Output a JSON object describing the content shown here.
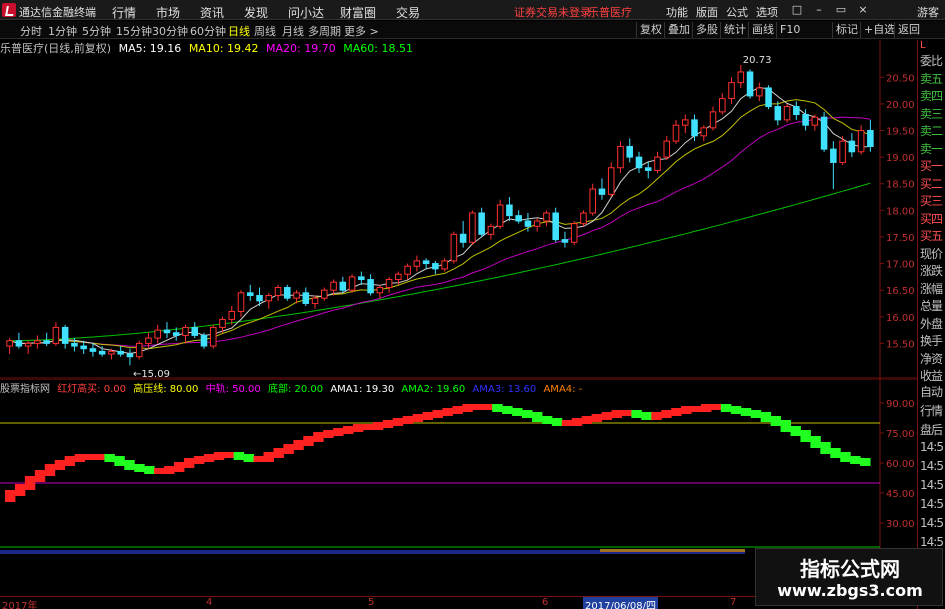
{
  "menubar": {
    "app_title": "通达信金融终端",
    "menus": [
      "行情",
      "市场",
      "资讯",
      "发现",
      "问小达",
      "财富圈",
      "交易"
    ],
    "status_text": "证券交易未登录",
    "stock_name": "乐普医疗",
    "right_items": [
      "功能",
      "版面",
      "公式",
      "选项"
    ],
    "guest": "游客"
  },
  "toolbar": {
    "periods": [
      "分时",
      "1分钟",
      "5分钟",
      "15分钟",
      "30分钟",
      "60分钟",
      "日线",
      "周线",
      "月线",
      "多周期",
      "更多 >"
    ],
    "active_period": "日线",
    "buttons": [
      "复权",
      "叠加",
      "多股",
      "统计",
      "画线",
      "F10",
      "标记",
      "+自选",
      "返回"
    ]
  },
  "main_header": {
    "title": "乐普医疗(日线,前复权)",
    "ma5": "MA5: 19.16",
    "ma10": "MA10: 19.42",
    "ma20": "MA20: 19.70",
    "ma60": "MA60: 18.51",
    "colors": {
      "ma5": "#ffffff",
      "ma10": "#ffff00",
      "ma20": "#ff00ff",
      "ma60": "#00ff00"
    }
  },
  "price_axis": [
    "20.50",
    "20.00",
    "19.50",
    "19.00",
    "18.50",
    "18.00",
    "17.50",
    "17.00",
    "16.50",
    "16.00",
    "15.50"
  ],
  "annotations": {
    "high": "20.73",
    "low": "15.09"
  },
  "side_panel": {
    "items": [
      "委比",
      "卖五",
      "卖四",
      "卖三",
      "卖二",
      "卖一",
      "买一",
      "买二",
      "买三",
      "买四",
      "买五",
      "现价",
      "涨跌",
      "涨幅",
      "总量",
      "外盘",
      "换手",
      "净资",
      "收益"
    ],
    "top_label": "L"
  },
  "side_panel2": {
    "items": [
      "自动",
      "行情",
      "盘后",
      "14:5",
      "14:5",
      "14:5",
      "14:5",
      "14:5",
      "14:5",
      "14:5"
    ]
  },
  "indicator_header": {
    "name": "股票指标网",
    "item1": "红灯高买: 0.00",
    "item2": "高压线: 80.00",
    "item3": "中轨: 50.00",
    "item4": "底部: 20.00",
    "item5": "AMA1: 19.30",
    "item6": "AMA2: 19.60",
    "item7": "AMA3: 13.60",
    "item8": "AMA4: -"
  },
  "indicator_axis": [
    "90.00",
    "75.00",
    "60.00",
    "45.00",
    "30.00"
  ],
  "date_axis": {
    "ticks": [
      "2017年",
      "4",
      "5",
      "6",
      "2017/06/08/四",
      "7"
    ],
    "selected": "2017/06/08/四"
  },
  "watermark": {
    "main": "指标公式网",
    "sub": "www.zbgs3.com"
  },
  "chart_data": {
    "type": "candlestick",
    "title": "乐普医疗(日线,前复权)",
    "ylim": [
      15.0,
      20.9
    ],
    "ma5_last": 19.16,
    "ma10_last": 19.42,
    "ma20_last": 19.7,
    "ma60_last": 18.51,
    "high": 20.73,
    "low": 15.09,
    "candles": [
      [
        15.45,
        15.6,
        15.3,
        15.55
      ],
      [
        15.55,
        15.7,
        15.4,
        15.45
      ],
      [
        15.45,
        15.55,
        15.3,
        15.5
      ],
      [
        15.5,
        15.65,
        15.4,
        15.55
      ],
      [
        15.55,
        15.7,
        15.45,
        15.5
      ],
      [
        15.5,
        15.9,
        15.45,
        15.8
      ],
      [
        15.8,
        15.85,
        15.4,
        15.5
      ],
      [
        15.5,
        15.6,
        15.35,
        15.45
      ],
      [
        15.45,
        15.55,
        15.3,
        15.4
      ],
      [
        15.4,
        15.5,
        15.25,
        15.35
      ],
      [
        15.35,
        15.45,
        15.25,
        15.3
      ],
      [
        15.3,
        15.4,
        15.2,
        15.35
      ],
      [
        15.35,
        15.45,
        15.25,
        15.3
      ],
      [
        15.3,
        15.4,
        15.09,
        15.25
      ],
      [
        15.25,
        15.55,
        15.2,
        15.5
      ],
      [
        15.5,
        15.7,
        15.4,
        15.6
      ],
      [
        15.6,
        15.85,
        15.5,
        15.75
      ],
      [
        15.75,
        15.9,
        15.6,
        15.7
      ],
      [
        15.7,
        15.8,
        15.55,
        15.65
      ],
      [
        15.65,
        15.85,
        15.5,
        15.8
      ],
      [
        15.8,
        15.9,
        15.6,
        15.65
      ],
      [
        15.65,
        15.7,
        15.4,
        15.45
      ],
      [
        15.45,
        15.85,
        15.4,
        15.8
      ],
      [
        15.8,
        16.0,
        15.7,
        15.95
      ],
      [
        15.95,
        16.2,
        15.85,
        16.1
      ],
      [
        16.1,
        16.5,
        16.0,
        16.45
      ],
      [
        16.45,
        16.6,
        16.3,
        16.4
      ],
      [
        16.4,
        16.55,
        16.2,
        16.3
      ],
      [
        16.3,
        16.45,
        16.15,
        16.4
      ],
      [
        16.4,
        16.6,
        16.3,
        16.55
      ],
      [
        16.55,
        16.6,
        16.3,
        16.35
      ],
      [
        16.35,
        16.5,
        16.25,
        16.45
      ],
      [
        16.45,
        16.55,
        16.2,
        16.25
      ],
      [
        16.25,
        16.4,
        16.15,
        16.35
      ],
      [
        16.35,
        16.55,
        16.3,
        16.5
      ],
      [
        16.5,
        16.7,
        16.4,
        16.65
      ],
      [
        16.65,
        16.75,
        16.45,
        16.5
      ],
      [
        16.5,
        16.8,
        16.45,
        16.75
      ],
      [
        16.75,
        16.85,
        16.6,
        16.7
      ],
      [
        16.7,
        16.8,
        16.4,
        16.45
      ],
      [
        16.45,
        16.6,
        16.35,
        16.55
      ],
      [
        16.55,
        16.75,
        16.45,
        16.7
      ],
      [
        16.7,
        16.85,
        16.6,
        16.8
      ],
      [
        16.8,
        17.0,
        16.7,
        16.95
      ],
      [
        16.95,
        17.15,
        16.85,
        17.05
      ],
      [
        17.05,
        17.1,
        16.9,
        17.0
      ],
      [
        17.0,
        17.05,
        16.8,
        16.9
      ],
      [
        16.9,
        17.1,
        16.85,
        17.05
      ],
      [
        17.05,
        17.6,
        17.0,
        17.55
      ],
      [
        17.55,
        17.8,
        17.3,
        17.4
      ],
      [
        17.4,
        18.0,
        17.35,
        17.95
      ],
      [
        17.95,
        18.05,
        17.5,
        17.55
      ],
      [
        17.55,
        17.75,
        17.45,
        17.7
      ],
      [
        17.7,
        18.2,
        17.65,
        18.1
      ],
      [
        18.1,
        18.25,
        17.8,
        17.9
      ],
      [
        17.9,
        18.0,
        17.75,
        17.8
      ],
      [
        17.8,
        17.95,
        17.6,
        17.7
      ],
      [
        17.7,
        17.85,
        17.6,
        17.8
      ],
      [
        17.8,
        18.0,
        17.7,
        17.95
      ],
      [
        17.95,
        18.05,
        17.4,
        17.45
      ],
      [
        17.45,
        17.6,
        17.3,
        17.4
      ],
      [
        17.4,
        17.8,
        17.35,
        17.75
      ],
      [
        17.75,
        18.0,
        17.7,
        17.95
      ],
      [
        17.95,
        18.5,
        17.9,
        18.4
      ],
      [
        18.4,
        18.6,
        18.2,
        18.3
      ],
      [
        18.3,
        18.9,
        18.25,
        18.8
      ],
      [
        18.8,
        19.3,
        18.7,
        19.2
      ],
      [
        19.2,
        19.35,
        18.9,
        19.0
      ],
      [
        19.0,
        19.1,
        18.7,
        18.8
      ],
      [
        18.8,
        18.9,
        18.6,
        18.75
      ],
      [
        18.75,
        19.1,
        18.7,
        19.0
      ],
      [
        19.0,
        19.4,
        18.95,
        19.3
      ],
      [
        19.3,
        19.7,
        19.25,
        19.6
      ],
      [
        19.6,
        19.8,
        19.45,
        19.7
      ],
      [
        19.7,
        19.8,
        19.3,
        19.4
      ],
      [
        19.4,
        19.6,
        19.3,
        19.55
      ],
      [
        19.55,
        19.95,
        19.5,
        19.85
      ],
      [
        19.85,
        20.2,
        19.8,
        20.1
      ],
      [
        20.1,
        20.5,
        20.0,
        20.4
      ],
      [
        20.4,
        20.73,
        20.3,
        20.6
      ],
      [
        20.6,
        20.65,
        20.1,
        20.15
      ],
      [
        20.15,
        20.4,
        20.05,
        20.3
      ],
      [
        20.3,
        20.35,
        19.9,
        19.95
      ],
      [
        19.95,
        20.05,
        19.6,
        19.7
      ],
      [
        19.7,
        20.0,
        19.65,
        19.95
      ],
      [
        19.95,
        20.05,
        19.7,
        19.8
      ],
      [
        19.8,
        19.9,
        19.5,
        19.6
      ],
      [
        19.6,
        19.8,
        19.5,
        19.75
      ],
      [
        19.75,
        19.85,
        19.1,
        19.15
      ],
      [
        19.15,
        19.3,
        18.4,
        18.9
      ],
      [
        18.9,
        19.4,
        18.85,
        19.3
      ],
      [
        19.3,
        19.45,
        19.0,
        19.1
      ],
      [
        19.1,
        19.6,
        19.05,
        19.5
      ],
      [
        19.5,
        19.7,
        19.1,
        19.2
      ]
    ],
    "indicator": {
      "lines": {
        "high": 80,
        "mid": 50,
        "bottom": 20
      },
      "ylim": [
        22,
        95
      ],
      "values": [
        42,
        45,
        48,
        52,
        55,
        58,
        60,
        62,
        63,
        63,
        63,
        62,
        60,
        58,
        57,
        56,
        56,
        57,
        59,
        61,
        62,
        63,
        64,
        64,
        63,
        62,
        62,
        64,
        66,
        68,
        70,
        72,
        74,
        75,
        76,
        77,
        78,
        78,
        79,
        80,
        81,
        82,
        83,
        84,
        85,
        86,
        87,
        88,
        88,
        88,
        87,
        86,
        85,
        84,
        82,
        81,
        80,
        80,
        81,
        82,
        83,
        84,
        85,
        85,
        84,
        83,
        84,
        85,
        86,
        87,
        87,
        88,
        88,
        87,
        86,
        85,
        84,
        82,
        80,
        77,
        75,
        72,
        69,
        66,
        64,
        62,
        61,
        60
      ]
    }
  }
}
